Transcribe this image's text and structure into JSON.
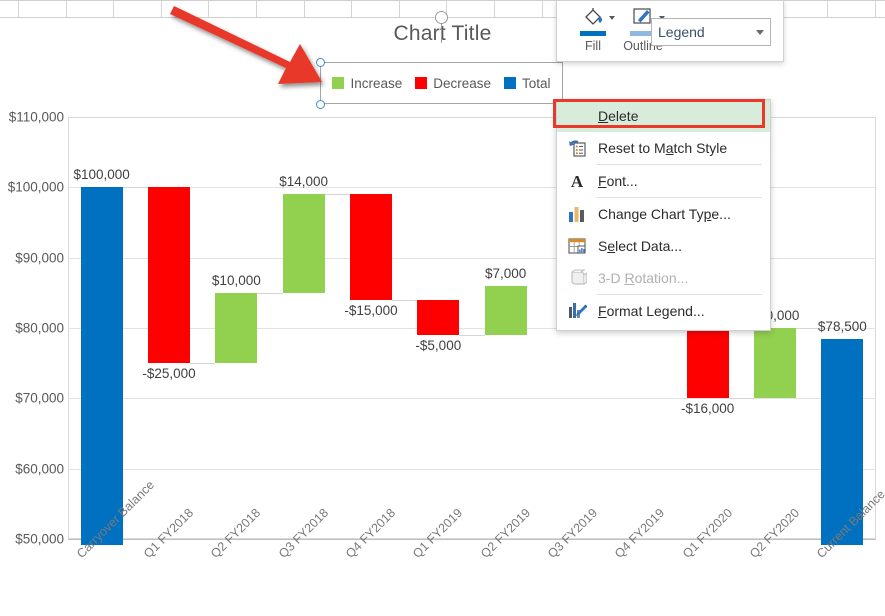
{
  "chart_data": {
    "type": "bar",
    "subtype": "waterfall",
    "title": "Chart Title",
    "xlabel": "",
    "ylabel": "",
    "ylim": [
      50000,
      110000
    ],
    "grid": true,
    "ytick_labels": [
      "$110,000",
      "$100,000",
      "$90,000",
      "$80,000",
      "$70,000",
      "$60,000",
      "$50,000"
    ],
    "ytick_values": [
      110000,
      100000,
      90000,
      80000,
      70000,
      60000,
      50000
    ],
    "legend_position": "top",
    "legend": [
      {
        "label": "Increase",
        "color": "#92D050"
      },
      {
        "label": "Decrease",
        "color": "#FF0000"
      },
      {
        "label": "Total",
        "color": "#0070C0"
      }
    ],
    "categories": [
      "Carryover Balance",
      "Q1 FY2018",
      "Q2 FY2018",
      "Q3 FY2018",
      "Q4 FY2018",
      "Q1 FY2019",
      "Q2 FY2019",
      "Q3 FY2019",
      "Q4 FY2019",
      "Q1 FY2020",
      "Q2 FY2020",
      "Current Balance"
    ],
    "data_labels": [
      "$100,000",
      "-$25,000",
      "$10,000",
      "$14,000",
      "-$15,000",
      "-$5,000",
      "$7,000",
      "",
      "",
      "-$16,000",
      "$10,000",
      "$78,500"
    ],
    "values": [
      100000,
      -25000,
      10000,
      14000,
      -15000,
      -5000,
      7000,
      0,
      0,
      -16000,
      10000,
      78500
    ],
    "cumulative": [
      100000,
      75000,
      85000,
      99000,
      84000,
      79000,
      86000,
      86000,
      86000,
      70000,
      80000,
      78500
    ],
    "types": [
      "total",
      "decrease",
      "increase",
      "increase",
      "decrease",
      "decrease",
      "increase",
      "none",
      "none",
      "decrease",
      "increase",
      "total"
    ]
  },
  "chart": {
    "title": "Chart Title"
  },
  "mini_toolbar": {
    "fill": {
      "label": "Fill",
      "icon": "fill-bucket-icon",
      "color": "#0070C0"
    },
    "outline": {
      "label": "Outline",
      "icon": "outline-pen-icon",
      "color": "#8EB9E0"
    },
    "element_select": {
      "value": "Legend",
      "icon": "chevron-down-icon"
    }
  },
  "context_menu": {
    "items": [
      {
        "label": "Delete",
        "accel": "D",
        "icon": "none",
        "highlighted": true,
        "disabled": false,
        "separator_after": false
      },
      {
        "label": "Reset to Match Style",
        "accel": "a",
        "icon": "reset-style-icon",
        "highlighted": false,
        "disabled": false,
        "separator_after": true
      },
      {
        "label": "Font...",
        "accel": "F",
        "icon": "font-a-icon",
        "highlighted": false,
        "disabled": false,
        "separator_after": true
      },
      {
        "label": "Change Chart Type...",
        "accel": "p",
        "icon": "chart-type-icon",
        "highlighted": false,
        "disabled": false,
        "separator_after": false
      },
      {
        "label": "Select Data...",
        "accel": "e",
        "icon": "select-data-icon",
        "highlighted": false,
        "disabled": false,
        "separator_after": false
      },
      {
        "label": "3-D Rotation...",
        "accel": "R",
        "icon": "rotation-3d-icon",
        "highlighted": false,
        "disabled": true,
        "separator_after": true
      },
      {
        "label": "Format Legend...",
        "accel": "F",
        "icon": "format-legend-icon",
        "highlighted": false,
        "disabled": false,
        "separator_after": false
      }
    ]
  },
  "annotations": {
    "arrow": {
      "name": "red-arrow",
      "color": "#E8392B"
    },
    "highlight_rect": {
      "name": "delete-highlight-rectangle",
      "color": "#E8392B"
    }
  },
  "selection": {
    "target": "Legend",
    "handle_color": "#3B8FD4"
  }
}
